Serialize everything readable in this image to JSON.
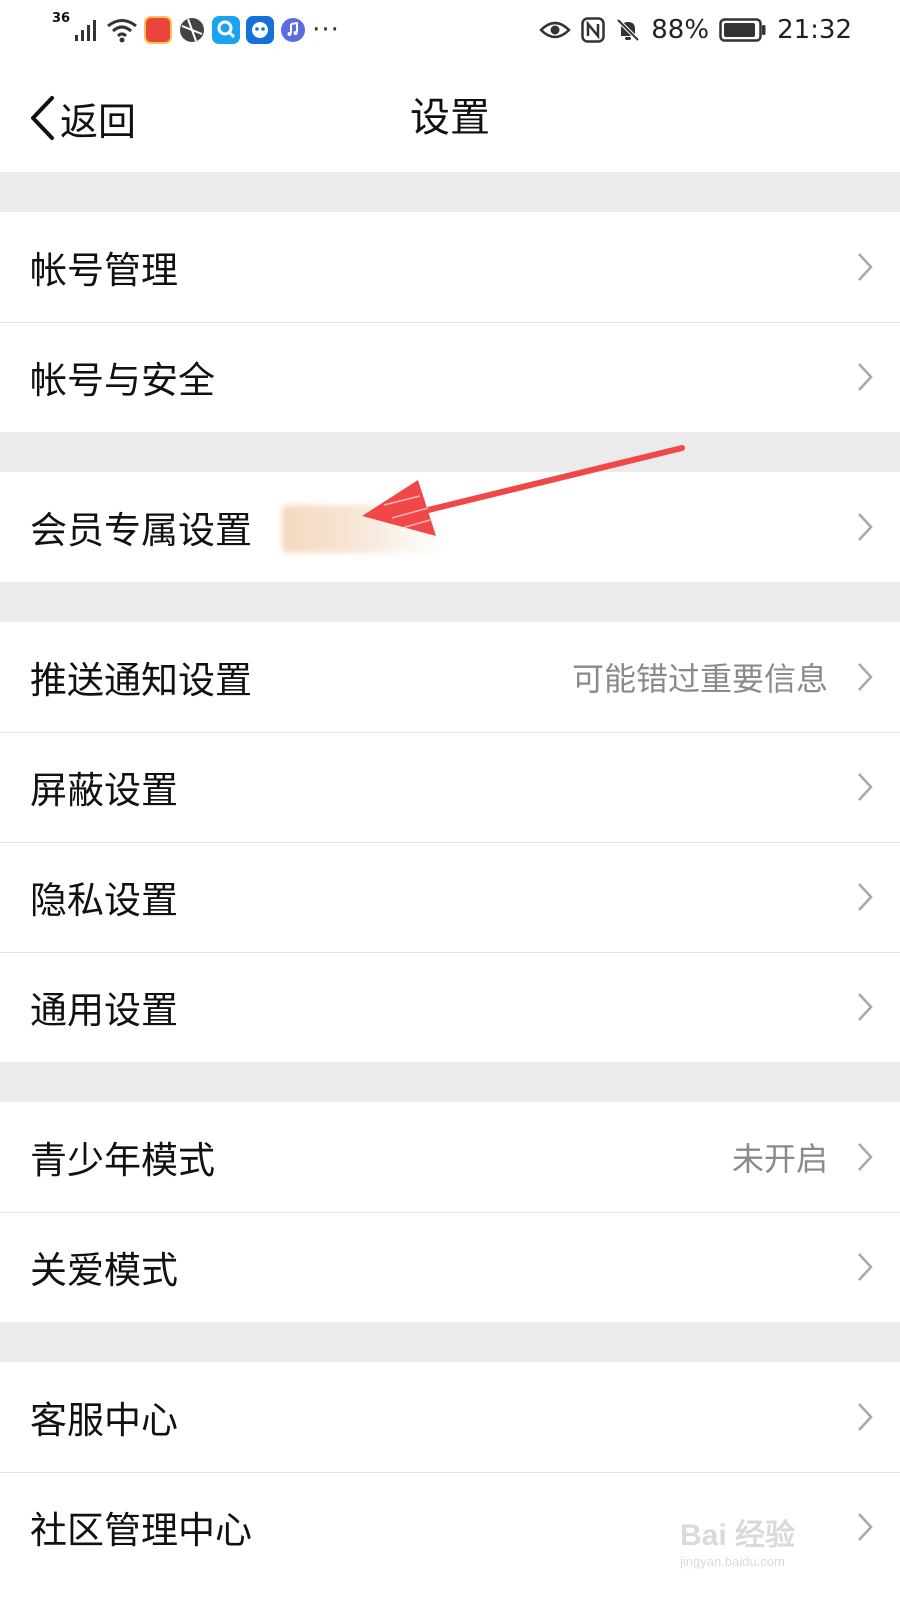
{
  "status_bar": {
    "network": "36",
    "battery": "88%",
    "time": "21:32",
    "icons": [
      "signal-icon",
      "wifi-icon",
      "app-calendar-icon",
      "app-ball-icon",
      "app-search-icon",
      "app-bot-icon",
      "music-icon",
      "more-icon",
      "eye-icon",
      "nfc-icon",
      "mute-bell-icon",
      "battery-icon"
    ]
  },
  "header": {
    "back_label": "返回",
    "title": "设置"
  },
  "sections": [
    {
      "items": [
        {
          "label": "帐号管理",
          "hint": ""
        },
        {
          "label": "帐号与安全",
          "hint": ""
        }
      ]
    },
    {
      "items": [
        {
          "label": "会员专属设置",
          "hint": ""
        }
      ]
    },
    {
      "items": [
        {
          "label": "推送通知设置",
          "hint": "可能错过重要信息"
        },
        {
          "label": "屏蔽设置",
          "hint": ""
        },
        {
          "label": "隐私设置",
          "hint": ""
        },
        {
          "label": "通用设置",
          "hint": ""
        }
      ]
    },
    {
      "items": [
        {
          "label": "青少年模式",
          "hint": "未开启"
        },
        {
          "label": "关爱模式",
          "hint": ""
        }
      ]
    },
    {
      "items": [
        {
          "label": "客服中心",
          "hint": ""
        },
        {
          "label": "社区管理中心",
          "hint": ""
        }
      ]
    }
  ],
  "watermark": {
    "main": "Bai 经验",
    "sub": "jingyan.baidu.com"
  },
  "colors": {
    "annotation_arrow": "#f04848",
    "section_gap": "#ebebeb",
    "hint_text": "#8a8a8a"
  }
}
